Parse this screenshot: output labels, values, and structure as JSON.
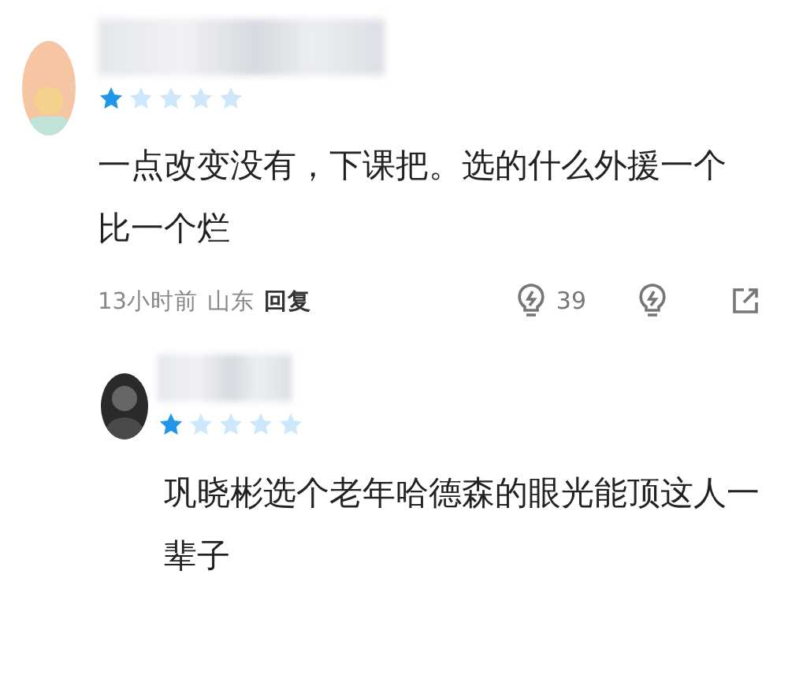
{
  "comments": [
    {
      "stars": 1,
      "text": "一点改变没有，下课把。选的什么外援一个比一个烂",
      "time": "13小时前",
      "location": "山东",
      "reply": "回复",
      "likes": "39"
    },
    {
      "stars": 1,
      "text": "巩晓彬选个老年哈德森的眼光能顶这人一辈子"
    }
  ]
}
